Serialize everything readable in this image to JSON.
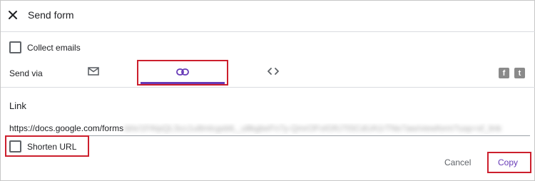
{
  "dialog": {
    "title": "Send form",
    "close_icon": "close-icon"
  },
  "collect_emails": {
    "label": "Collect emails",
    "checked": false
  },
  "send_via": {
    "label": "Send via",
    "tabs": [
      {
        "name": "email",
        "icon": "envelope-icon",
        "selected": false
      },
      {
        "name": "link",
        "icon": "link-icon",
        "selected": true
      },
      {
        "name": "embed",
        "icon": "code-icon",
        "selected": false
      }
    ],
    "social": [
      {
        "name": "facebook",
        "icon": "facebook-icon",
        "glyph": "f"
      },
      {
        "name": "twitter",
        "icon": "twitter-icon",
        "glyph": "t"
      }
    ]
  },
  "link": {
    "heading": "Link",
    "url_visible": "https://docs.google.com/forms",
    "url_obscured": "/d/e/1FAIpQLScc1u8mlcgsblL_u8kgbeFn7y-QmrOFoIGfU7tSCdUA1rTNe7aw/viewform?usp=sf_link",
    "shorten_label": "Shorten URL",
    "shorten_checked": false
  },
  "actions": {
    "cancel_label": "Cancel",
    "copy_label": "Copy"
  },
  "colors": {
    "accent": "#673ab7",
    "highlight": "#cc1f2d",
    "icon_gray": "#5f6368",
    "divider": "#dadce0"
  }
}
